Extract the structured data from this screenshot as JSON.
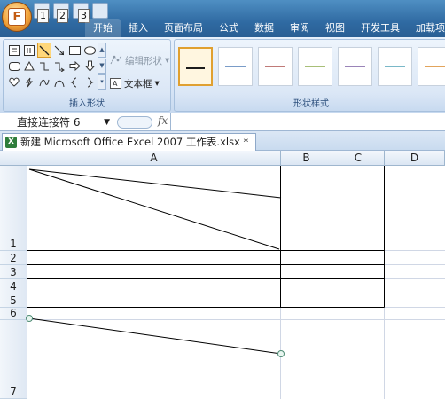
{
  "app": {
    "office_button_letter": "F",
    "key_tips": [
      "1",
      "2",
      "3"
    ]
  },
  "ribbon": {
    "tabs": [
      {
        "label": "开始"
      },
      {
        "label": "插入"
      },
      {
        "label": "页面布局"
      },
      {
        "label": "公式"
      },
      {
        "label": "数据"
      },
      {
        "label": "审阅"
      },
      {
        "label": "视图"
      },
      {
        "label": "开发工具"
      },
      {
        "label": "加载项"
      }
    ],
    "insert_shapes_group": {
      "label": "插入形状",
      "edit_shape_label": "编辑形状",
      "text_box_label": "文本框",
      "shapes": [
        "text-box",
        "vertical-text-box",
        "line",
        "arrow",
        "rectangle",
        "oval",
        "rounded-rectangle",
        "triangle",
        "elbow-connector",
        "elbow-arrow-connector",
        "right-arrow",
        "down-arrow",
        "heart",
        "lightning",
        "left-brace-curve",
        "curve",
        "left-brace",
        "right-brace"
      ],
      "selected_shape": "line"
    },
    "shape_styles_group": {
      "label": "形状样式",
      "line_colors": [
        "#1c1c1c",
        "#7a9cc8",
        "#c07a78",
        "#a8bf78",
        "#9a84b8",
        "#7ab8c8",
        "#e2a45c"
      ]
    }
  },
  "formula_bar": {
    "name_box_value": "直接连接符 6",
    "fx_label": "fx",
    "content": ""
  },
  "workbook": {
    "tab_title": "新建 Microsoft Office Excel 2007 工作表.xlsx *",
    "icon_letter": "X"
  },
  "sheet": {
    "columns": [
      "A",
      "B",
      "C",
      "D"
    ],
    "rows": [
      "1",
      "2",
      "3",
      "4",
      "5",
      "6",
      "7"
    ]
  }
}
